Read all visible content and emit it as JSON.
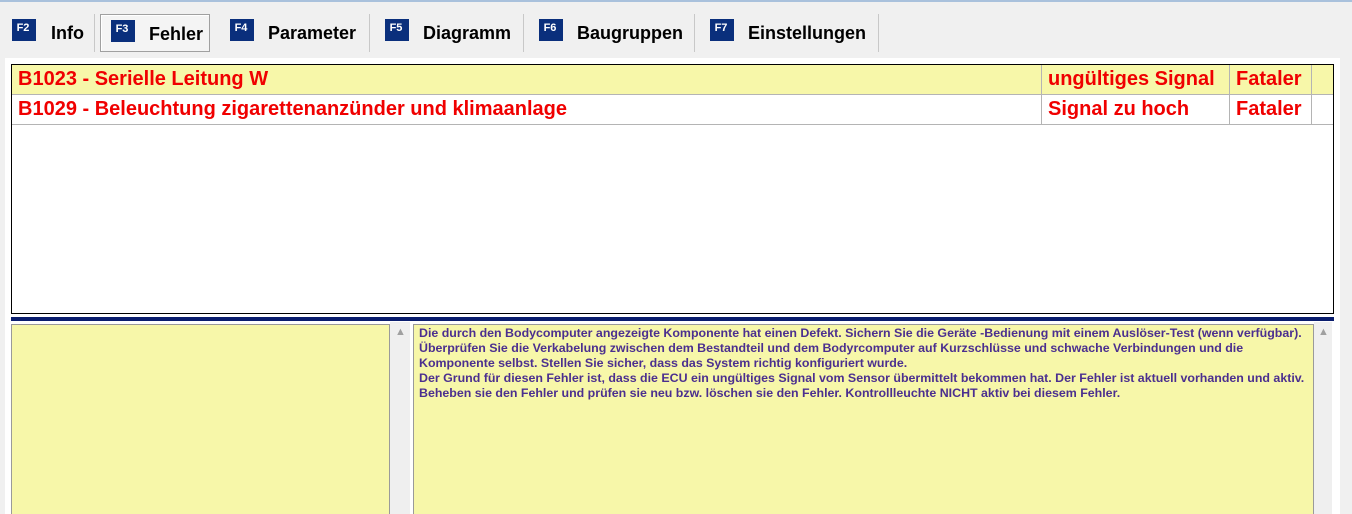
{
  "tabs": [
    {
      "key": "F2",
      "label": "Info"
    },
    {
      "key": "F3",
      "label": "Fehler"
    },
    {
      "key": "F4",
      "label": "Parameter"
    },
    {
      "key": "F5",
      "label": "Diagramm"
    },
    {
      "key": "F6",
      "label": "Baugruppen"
    },
    {
      "key": "F7",
      "label": "Einstellungen"
    }
  ],
  "active_tab": "Fehler",
  "faults": [
    {
      "code_text": "B1023 - Serielle Leitung W",
      "status": "ungültiges Signal",
      "severity": "Fataler",
      "selected": true
    },
    {
      "code_text": "B1029 - Beleuchtung zigarettenanzünder und klimaanlage",
      "status": "Signal zu hoch",
      "severity": "Fataler",
      "selected": false
    }
  ],
  "description": {
    "paragraph1": "Die durch den Bodycomputer angezeigte Komponente hat einen Defekt. Sichern Sie die Geräte -Bedienung mit einem Auslöser-Test (wenn verfügbar). Überprüfen Sie die Verkabelung zwischen dem Bestandteil und dem Bodyrcomputer auf Kurzschlüsse und schwache Verbindungen und die Komponente selbst. Stellen Sie sicher, dass das System richtig konfiguriert wurde.",
    "paragraph2": "Der Grund für diesen Fehler ist, dass die ECU ein ungültiges Signal vom Sensor übermittelt bekommen hat. Der Fehler ist aktuell vorhanden und aktiv. Beheben sie den Fehler und prüfen sie neu bzw. löschen sie den Fehler. Kontrollleuchte NICHT aktiv bei diesem Fehler."
  },
  "colors": {
    "fault_text": "#f00000",
    "selected_row": "#f7f7a9",
    "fkey_badge": "#0a2f7c",
    "description_text": "#4b2f8f"
  }
}
